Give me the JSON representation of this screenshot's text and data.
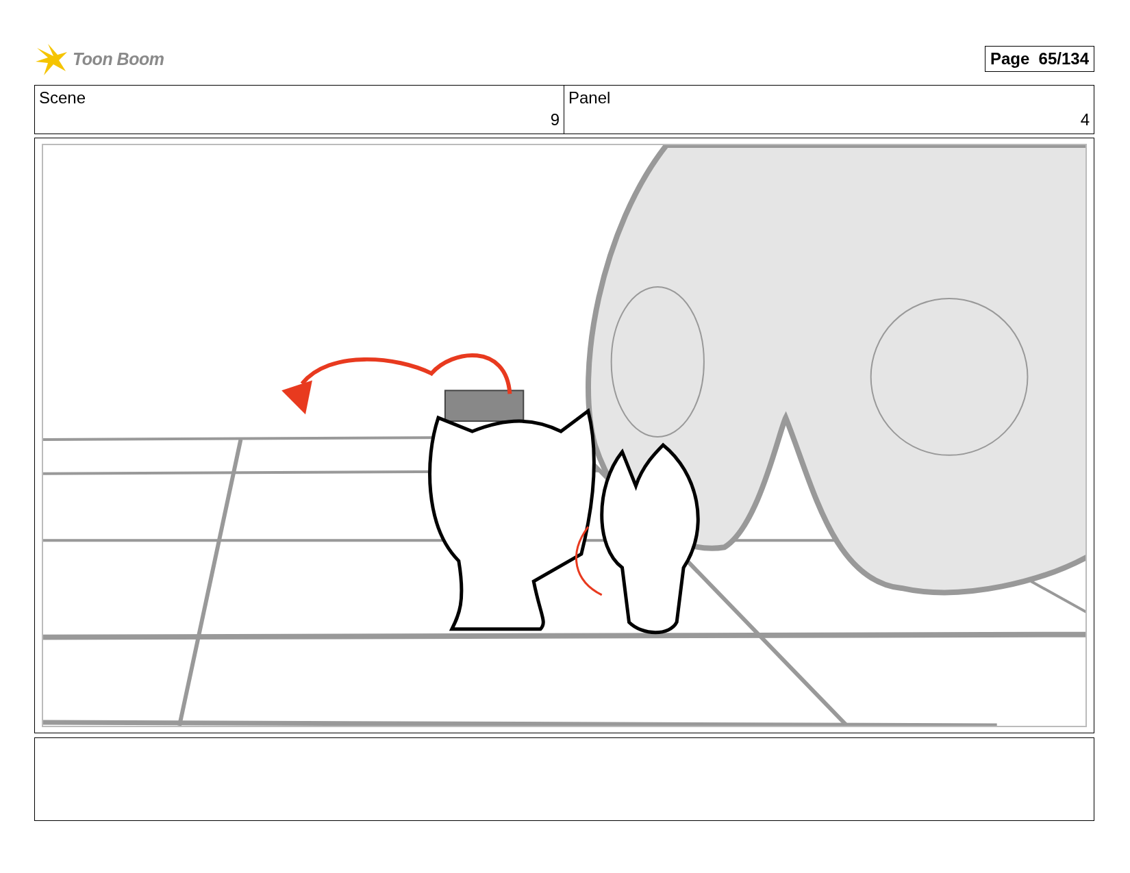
{
  "logo": {
    "text": "Toon Boom"
  },
  "page_label": "Page  65/134",
  "header_cells": [
    {
      "heading": "Scene",
      "number": "9"
    },
    {
      "heading": "Panel",
      "number": "4"
    }
  ]
}
